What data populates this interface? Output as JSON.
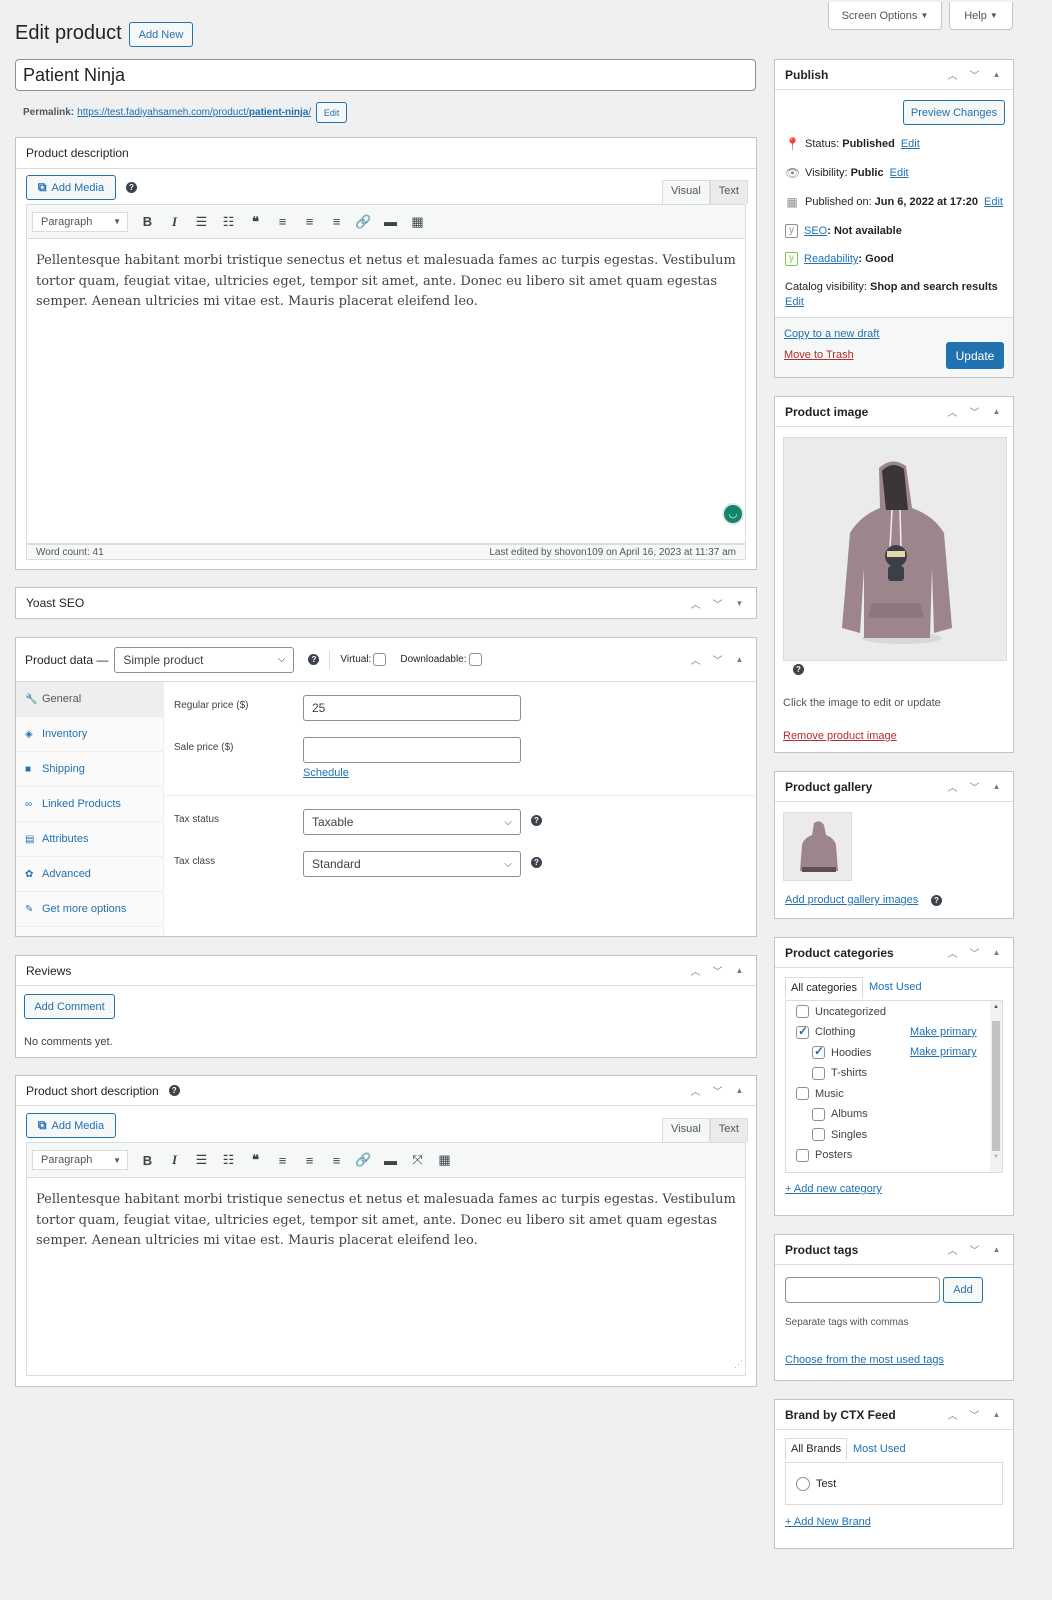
{
  "header": {
    "title": "Edit product",
    "add_new": "Add New",
    "screen_options": "Screen Options",
    "help": "Help"
  },
  "post": {
    "title_value": "Patient Ninja",
    "permalink_label": "Permalink:",
    "permalink_base": "https://test.fadiyahsameh.com/product/",
    "permalink_slug": "patient-ninja",
    "permalink_trail": "/",
    "permalink_edit": "Edit"
  },
  "description": {
    "title": "Product description",
    "add_media": "Add Media",
    "tab_visual": "Visual",
    "tab_text": "Text",
    "format": "Paragraph",
    "content": "Pellentesque habitant morbi tristique senectus et netus et malesuada fames ac turpis egestas. Vestibulum tortor quam, feugiat vitae, ultricies eget, tempor sit amet, ante. Donec eu libero sit amet quam egestas semper. Aenean ultricies mi vitae est. Mauris placerat eleifend leo.",
    "word_count": "Word count: 41",
    "last_edited": "Last edited by shovon109 on April 16, 2023 at 11:37 am"
  },
  "yoast": {
    "title": "Yoast SEO"
  },
  "product_data": {
    "title": "Product data —",
    "type": "Simple product",
    "virtual_label": "Virtual:",
    "virtual_checked": false,
    "downloadable_label": "Downloadable:",
    "downloadable_checked": false,
    "tabs": [
      {
        "label": "General",
        "icon": "wrench-icon",
        "glyph": "🔧",
        "active": true
      },
      {
        "label": "Inventory",
        "icon": "tag-icon",
        "glyph": "◈",
        "active": false
      },
      {
        "label": "Shipping",
        "icon": "truck-icon",
        "glyph": "■",
        "active": false
      },
      {
        "label": "Linked Products",
        "icon": "link-icon",
        "glyph": "∞",
        "active": false
      },
      {
        "label": "Attributes",
        "icon": "list-icon",
        "glyph": "▤",
        "active": false
      },
      {
        "label": "Advanced",
        "icon": "gear-icon",
        "glyph": "✿",
        "active": false
      },
      {
        "label": "Get more options",
        "icon": "plugin-icon",
        "glyph": "✎",
        "active": false
      }
    ],
    "regular_price_label": "Regular price ($)",
    "regular_price_value": "25",
    "sale_price_label": "Sale price ($)",
    "sale_price_value": "",
    "schedule": "Schedule",
    "tax_status_label": "Tax status",
    "tax_status_value": "Taxable",
    "tax_class_label": "Tax class",
    "tax_class_value": "Standard"
  },
  "reviews": {
    "title": "Reviews",
    "add_comment": "Add Comment",
    "empty": "No comments yet."
  },
  "short_description": {
    "title": "Product short description",
    "add_media": "Add Media",
    "tab_visual": "Visual",
    "tab_text": "Text",
    "format": "Paragraph",
    "content": "Pellentesque habitant morbi tristique senectus et netus et malesuada fames ac turpis egestas. Vestibulum tortor quam, feugiat vitae, ultricies eget, tempor sit amet, ante. Donec eu libero sit amet quam egestas semper. Aenean ultricies mi vitae est. Mauris placerat eleifend leo."
  },
  "publish": {
    "title": "Publish",
    "preview": "Preview Changes",
    "status_label": "Status:",
    "status_value": "Published",
    "visibility_label": "Visibility:",
    "visibility_value": "Public",
    "published_label": "Published on:",
    "published_value": "Jun 6, 2022 at 17:20",
    "seo_link": "SEO",
    "seo_value": ": Not available",
    "readability_link": "Readability",
    "readability_value": ": Good",
    "catalog_label": "Catalog visibility:",
    "catalog_value": "Shop and search results",
    "edit": "Edit",
    "copy_draft": "Copy to a new draft",
    "trash": "Move to Trash",
    "update": "Update"
  },
  "product_image": {
    "title": "Product image",
    "hint": "Click the image to edit or update",
    "remove": "Remove product image"
  },
  "gallery": {
    "title": "Product gallery",
    "add": "Add product gallery images"
  },
  "categories": {
    "title": "Product categories",
    "tab_all": "All categories",
    "tab_most": "Most Used",
    "make_primary": "Make primary",
    "items": [
      {
        "label": "Uncategorized",
        "checked": false,
        "level": 0,
        "primary": false
      },
      {
        "label": "Clothing",
        "checked": true,
        "level": 0,
        "primary": true
      },
      {
        "label": "Hoodies",
        "checked": true,
        "level": 1,
        "primary": true
      },
      {
        "label": "T-shirts",
        "checked": false,
        "level": 1,
        "primary": false
      },
      {
        "label": "Music",
        "checked": false,
        "level": 0,
        "primary": false
      },
      {
        "label": "Albums",
        "checked": false,
        "level": 1,
        "primary": false
      },
      {
        "label": "Singles",
        "checked": false,
        "level": 1,
        "primary": false
      },
      {
        "label": "Posters",
        "checked": false,
        "level": 0,
        "primary": false
      }
    ],
    "add_new": "+ Add new category"
  },
  "tags": {
    "title": "Product tags",
    "input_value": "",
    "add": "Add",
    "hint": "Separate tags with commas",
    "choose": "Choose from the most used tags"
  },
  "brand": {
    "title": "Brand by CTX Feed",
    "tab_all": "All Brands",
    "tab_most": "Most Used",
    "options": [
      {
        "label": "Test",
        "selected": false
      }
    ],
    "add_new": "+ Add New Brand"
  },
  "colors": {
    "accent": "#2271b1",
    "trash": "#b32d2e",
    "grammarly": "#15846d",
    "yoast_good": "#7ad03a"
  }
}
